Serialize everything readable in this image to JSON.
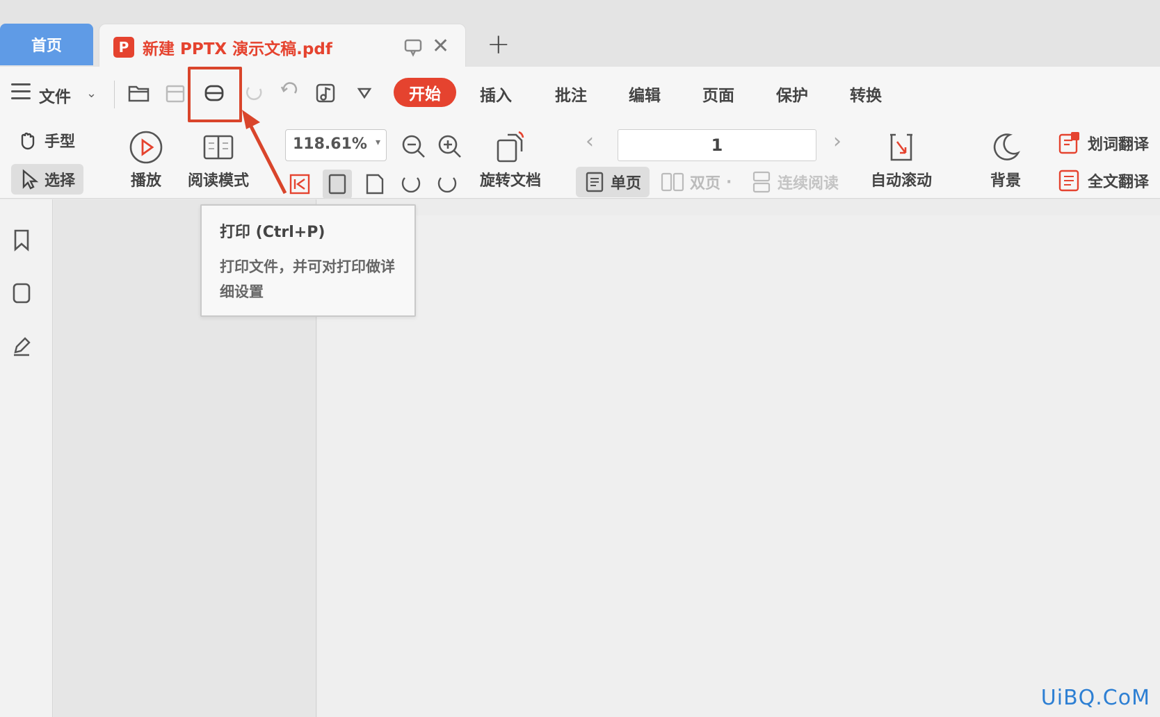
{
  "tabs": {
    "home_label": "首页",
    "doc_logo": "P",
    "doc_title": "新建 PPTX 演示文稿.pdf",
    "new_tab": "+"
  },
  "menu": {
    "file_label": "文件",
    "ribbon_tabs": [
      "开始",
      "插入",
      "批注",
      "编辑",
      "页面",
      "保护",
      "转换"
    ],
    "active_tab": "开始"
  },
  "toolbar": {
    "hand_label": "手型",
    "select_label": "选择",
    "play_label": "播放",
    "read_mode_label": "阅读模式",
    "zoom_value": "118.61%",
    "rotate_label": "旋转文档",
    "page_value": "1",
    "single_page_label": "单页",
    "double_page_label": "双页",
    "continuous_label": "连续阅读",
    "auto_scroll_label": "自动滚动",
    "background_label": "背景",
    "word_translate_label": "划词翻译",
    "full_translate_label": "全文翻译"
  },
  "tooltip": {
    "title": "打印 (Ctrl+P)",
    "description": "打印文件，并可对打印做详细设置"
  },
  "colors": {
    "accent": "#e5432f",
    "home_tab": "#5f9be6",
    "highlight_box": "#d9452b"
  },
  "watermark": "UiBQ.CoM"
}
